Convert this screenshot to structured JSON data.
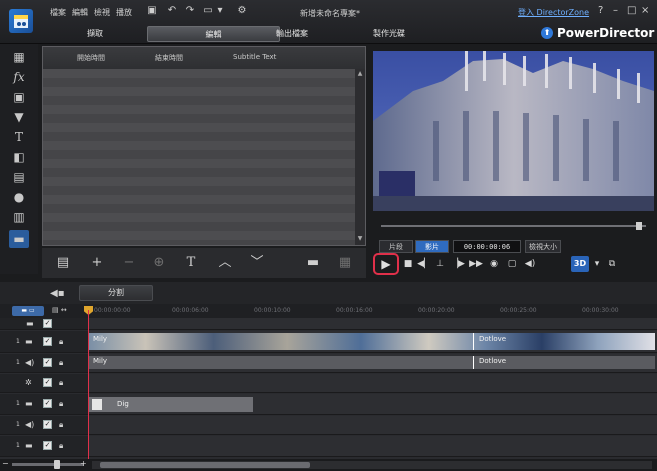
{
  "app": {
    "brand": "PowerDirector",
    "project_title": "新增未命名專案*",
    "login_link": "登入 DirectorZone"
  },
  "menu": [
    "檔案",
    "編輯",
    "檢視",
    "播放"
  ],
  "mode_tabs": [
    "擷取",
    "編輯",
    "輸出檔案",
    "製作光碟"
  ],
  "window_buttons": [
    "?",
    "–",
    "□",
    "×"
  ],
  "library": {
    "columns": [
      "開始時間",
      "結束時間",
      "Subtitle Text"
    ]
  },
  "split_button": "分割",
  "preview": {
    "clip_label": "片段",
    "movie_label": "影片",
    "timecode": "00:00:00:06",
    "ratio_label": "檢視大小",
    "three_d": "3D"
  },
  "timeline": {
    "ticks": [
      "00:00:00:00",
      "00:00:06:00",
      "00:00:10:00",
      "00:00:16:00",
      "00:00:20:00",
      "00:00:25:00",
      "00:00:30:00"
    ],
    "tracks": [
      {
        "name": "video-track-1",
        "type": "video"
      },
      {
        "name": "audio-track-1",
        "type": "audio"
      },
      {
        "name": "fx-track",
        "type": "fx"
      },
      {
        "name": "title-track",
        "type": "title"
      },
      {
        "name": "voice-track",
        "type": "audio"
      },
      {
        "name": "music-track",
        "type": "audio"
      }
    ],
    "video_clip_a": "Mily",
    "video_clip_b": "Dotlove",
    "audio_clip_a": "Mily",
    "audio_clip_b": "Dotlove",
    "title_clip": "Dig"
  },
  "colors": {
    "accent_blue": "#2f6bbf",
    "highlight_red": "#e0304a",
    "playhead": "#e0304a"
  }
}
